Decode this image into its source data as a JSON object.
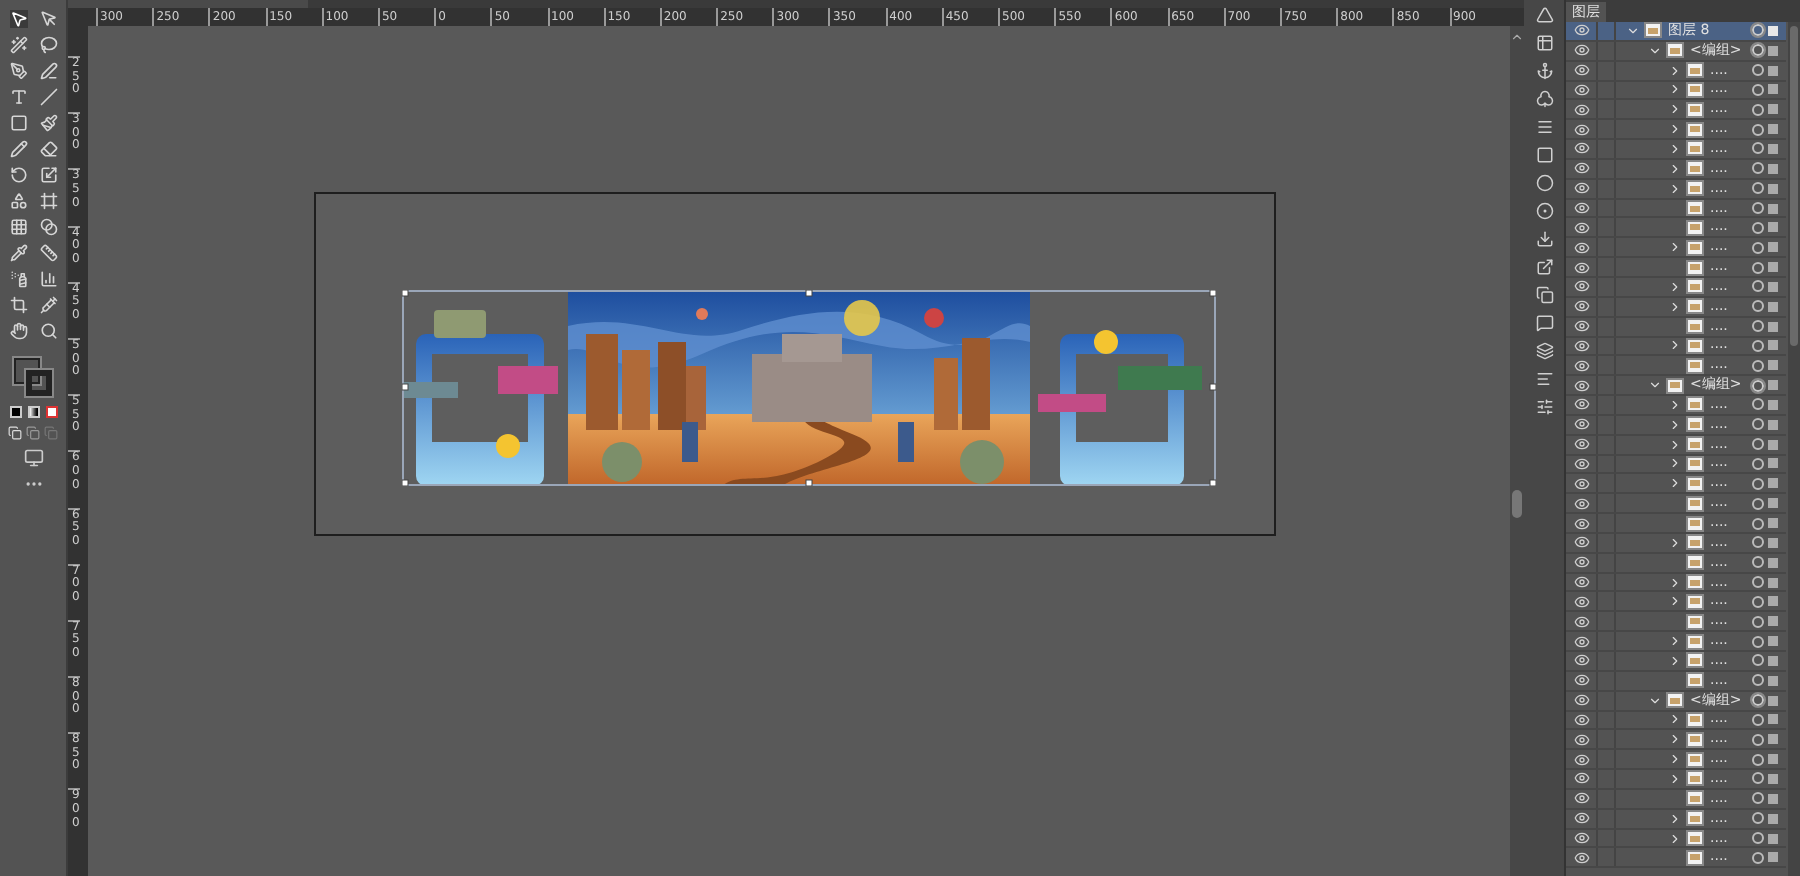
{
  "rulers": {
    "horizontal": [
      "300",
      "250",
      "200",
      "150",
      "100",
      "50",
      "0",
      "50",
      "100",
      "150",
      "200",
      "250",
      "300",
      "350",
      "400",
      "450",
      "500",
      "550",
      "600",
      "650",
      "700",
      "750",
      "800",
      "850",
      "900"
    ],
    "vertical": [
      "250",
      "300",
      "350",
      "400",
      "450",
      "500",
      "550",
      "600",
      "650",
      "700",
      "750",
      "800",
      "850",
      "900"
    ]
  },
  "layers_panel": {
    "tab": "图层",
    "layers": [
      {
        "name": "图层 8",
        "expanded": true,
        "selected": true,
        "children": [
          {
            "name": "<编组>",
            "expanded": true,
            "selected": false,
            "children": [
              {
                "name": "....",
                "expandable": true
              },
              {
                "name": "....",
                "expandable": true
              },
              {
                "name": "....",
                "expandable": true
              },
              {
                "name": "....",
                "expandable": true
              },
              {
                "name": "....",
                "expandable": true
              },
              {
                "name": "....",
                "expandable": true
              },
              {
                "name": "....",
                "expandable": true
              },
              {
                "name": "....",
                "expandable": false
              },
              {
                "name": "....",
                "expandable": false
              },
              {
                "name": "....",
                "expandable": true
              },
              {
                "name": "....",
                "expandable": false
              },
              {
                "name": "....",
                "expandable": true
              },
              {
                "name": "....",
                "expandable": true
              },
              {
                "name": "....",
                "expandable": false
              },
              {
                "name": "....",
                "expandable": true
              },
              {
                "name": "....",
                "expandable": false
              }
            ]
          },
          {
            "name": "<编组>",
            "expanded": true,
            "selected": false,
            "children": [
              {
                "name": "....",
                "expandable": true
              },
              {
                "name": "....",
                "expandable": true
              },
              {
                "name": "....",
                "expandable": true
              },
              {
                "name": "....",
                "expandable": true
              },
              {
                "name": "....",
                "expandable": true
              },
              {
                "name": "....",
                "expandable": false
              },
              {
                "name": "....",
                "expandable": false
              },
              {
                "name": "....",
                "expandable": true
              },
              {
                "name": "....",
                "expandable": false
              },
              {
                "name": "....",
                "expandable": true
              },
              {
                "name": "....",
                "expandable": true
              },
              {
                "name": "....",
                "expandable": false
              },
              {
                "name": "....",
                "expandable": true
              },
              {
                "name": "....",
                "expandable": true
              },
              {
                "name": "....",
                "expandable": false
              }
            ]
          },
          {
            "name": "<编组>",
            "expanded": true,
            "selected": false,
            "children": [
              {
                "name": "....",
                "expandable": true
              },
              {
                "name": "....",
                "expandable": true
              },
              {
                "name": "....",
                "expandable": true
              },
              {
                "name": "....",
                "expandable": true
              },
              {
                "name": "....",
                "expandable": false
              },
              {
                "name": "....",
                "expandable": true
              },
              {
                "name": "....",
                "expandable": true
              },
              {
                "name": "....",
                "expandable": false
              }
            ]
          }
        ]
      }
    ]
  }
}
